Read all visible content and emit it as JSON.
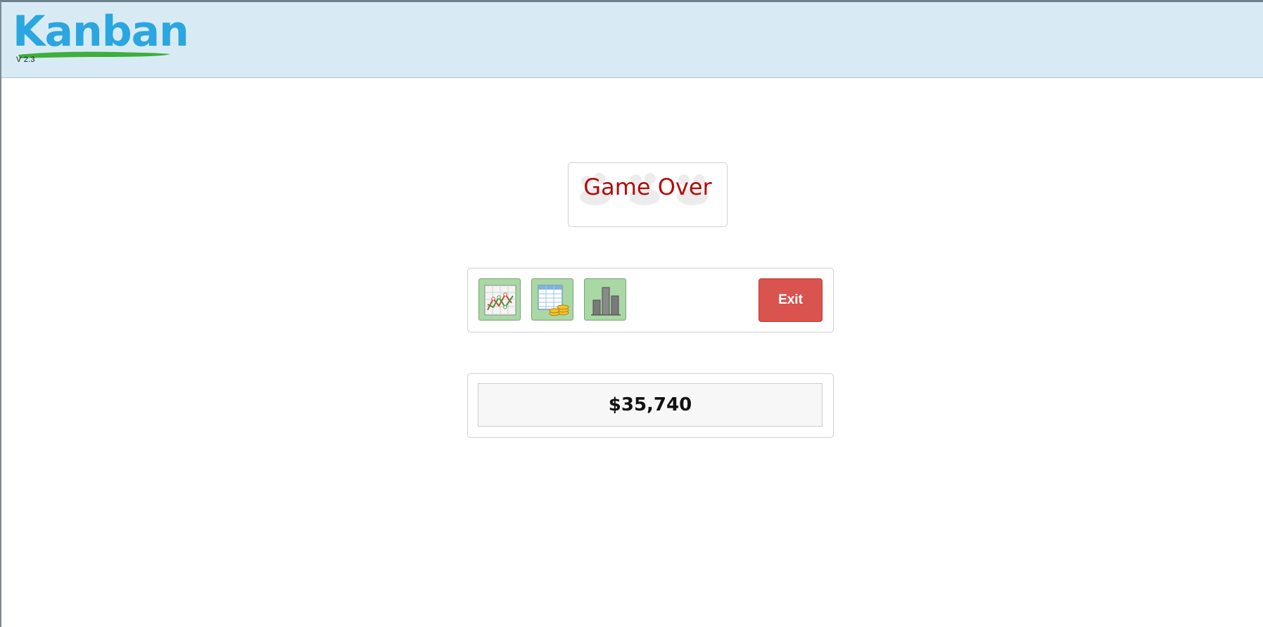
{
  "header": {
    "logo_text": "Kanban",
    "version": "V 2.3"
  },
  "game_over": {
    "title": "Game Over"
  },
  "toolbar": {
    "buttons": [
      {
        "icon": "line-chart-icon"
      },
      {
        "icon": "spreadsheet-coins-icon"
      },
      {
        "icon": "bar-chart-icon"
      }
    ],
    "exit_label": "Exit"
  },
  "score": {
    "value": "$35,740"
  },
  "colors": {
    "header_bg": "#d8ebf5",
    "logo_blue": "#2aa6e0",
    "logo_green": "#3fae3c",
    "game_over_red": "#b30b0b",
    "tool_button_green": "#a9d8a4",
    "exit_red": "#d9534f"
  }
}
